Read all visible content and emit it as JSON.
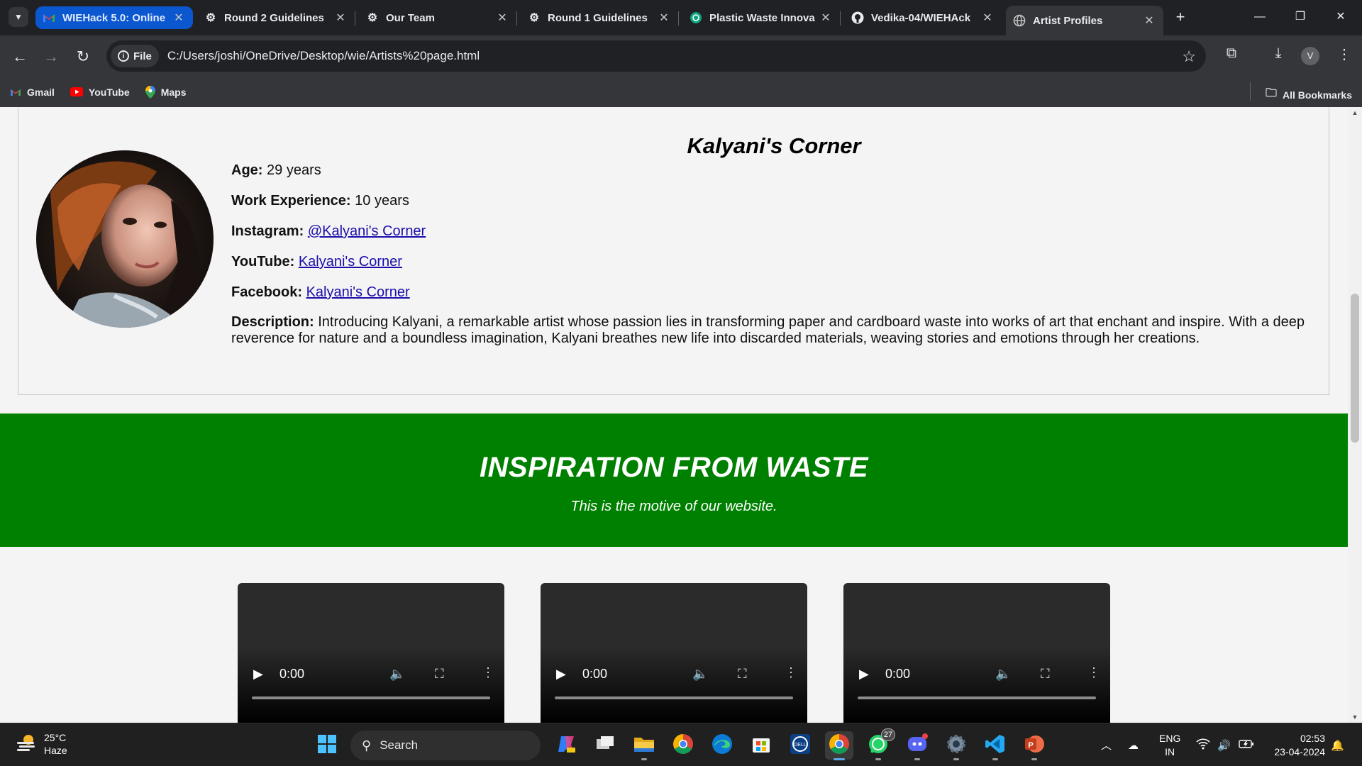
{
  "browser": {
    "tabs": [
      {
        "title": "WIEHack 5.0: Online",
        "icon": "gmail-icon"
      },
      {
        "title": "Round 2 Guidelines",
        "icon": "app-icon"
      },
      {
        "title": "Our Team",
        "icon": "app-icon"
      },
      {
        "title": "Round 1 Guidelines",
        "icon": "app-icon"
      },
      {
        "title": "Plastic Waste Innova",
        "icon": "chatgpt-icon"
      },
      {
        "title": "Vedika-04/WIEHAck",
        "icon": "github-icon"
      },
      {
        "title": "Artist Profiles",
        "icon": "globe-icon"
      }
    ],
    "address": {
      "scheme_label": "File",
      "url": "C:/Users/joshi/OneDrive/Desktop/wie/Artists%20page.html"
    },
    "profile_initial": "V",
    "bookmarks": [
      {
        "label": "Gmail",
        "icon": "gmail-icon"
      },
      {
        "label": "YouTube",
        "icon": "youtube-icon"
      },
      {
        "label": "Maps",
        "icon": "maps-icon"
      }
    ],
    "all_bookmarks_label": "All Bookmarks"
  },
  "artist": {
    "name": "Kalyani's Corner",
    "age_label": "Age:",
    "age_value": "29 years",
    "experience_label": "Work Experience:",
    "experience_value": "10 years",
    "instagram_label": "Instagram:",
    "instagram_link": "@Kalyani's Corner",
    "youtube_label": "YouTube:",
    "youtube_link": "Kalyani's Corner",
    "facebook_label": "Facebook:",
    "facebook_link": "Kalyani's Corner",
    "description_label": "Description:",
    "description": "Introducing Kalyani, a remarkable artist whose passion lies in transforming paper and cardboard waste into works of art that enchant and inspire. With a deep reverence for nature and a boundless imagination, Kalyani breathes new life into discarded materials, weaving stories and emotions through her creations."
  },
  "banner": {
    "title": "INSPIRATION FROM WASTE",
    "subtitle": "This is the motive of our website."
  },
  "videos": [
    {
      "time": "0:00"
    },
    {
      "time": "0:00"
    },
    {
      "time": "0:00"
    }
  ],
  "taskbar": {
    "weather_temp": "25°C",
    "weather_desc": "Haze",
    "search_placeholder": "Search",
    "whatsapp_badge": "27",
    "language": "ENG",
    "region": "IN",
    "time": "02:53",
    "date": "23-04-2024"
  },
  "colors": {
    "banner_green": "#008000",
    "link_blue": "#1a0dab",
    "chrome_dark": "#202124",
    "chrome_toolbar": "#35363a"
  }
}
